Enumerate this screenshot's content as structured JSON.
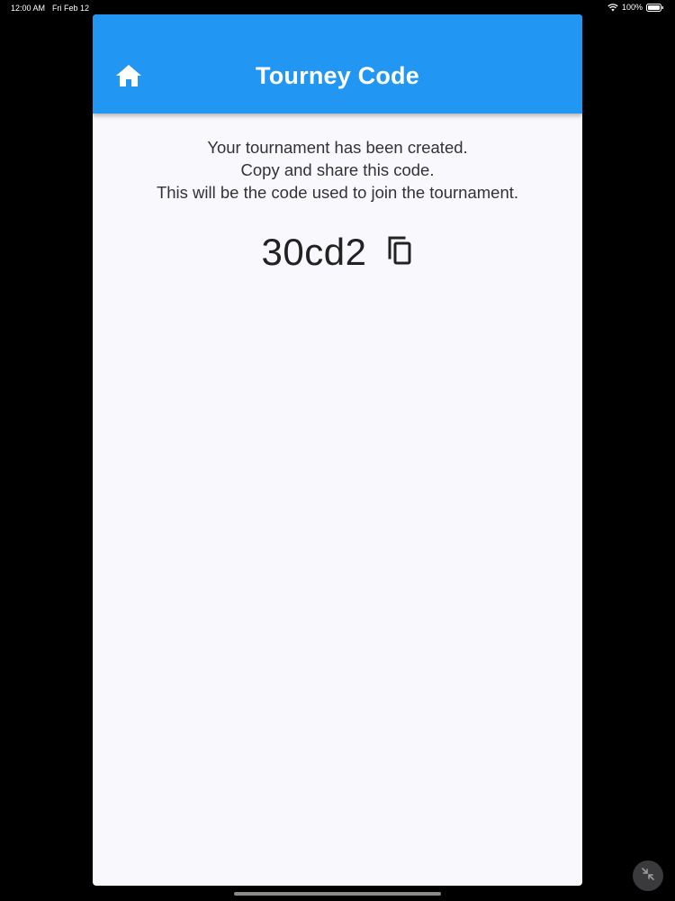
{
  "status_bar": {
    "time": "12:00 AM",
    "date": "Fri Feb 12",
    "battery": "100%"
  },
  "app_bar": {
    "title": "Tourney Code",
    "home_icon": "home-icon"
  },
  "message": {
    "line1": "Your tournament has been created.",
    "line2": "Copy and share this code.",
    "line3": "This will be the code used to join the tournament."
  },
  "code": {
    "value": "30cd2",
    "copy_icon": "copy-icon"
  },
  "colors": {
    "app_bar": "#2196f3",
    "background": "#f9f8fc",
    "text": "#333333"
  }
}
